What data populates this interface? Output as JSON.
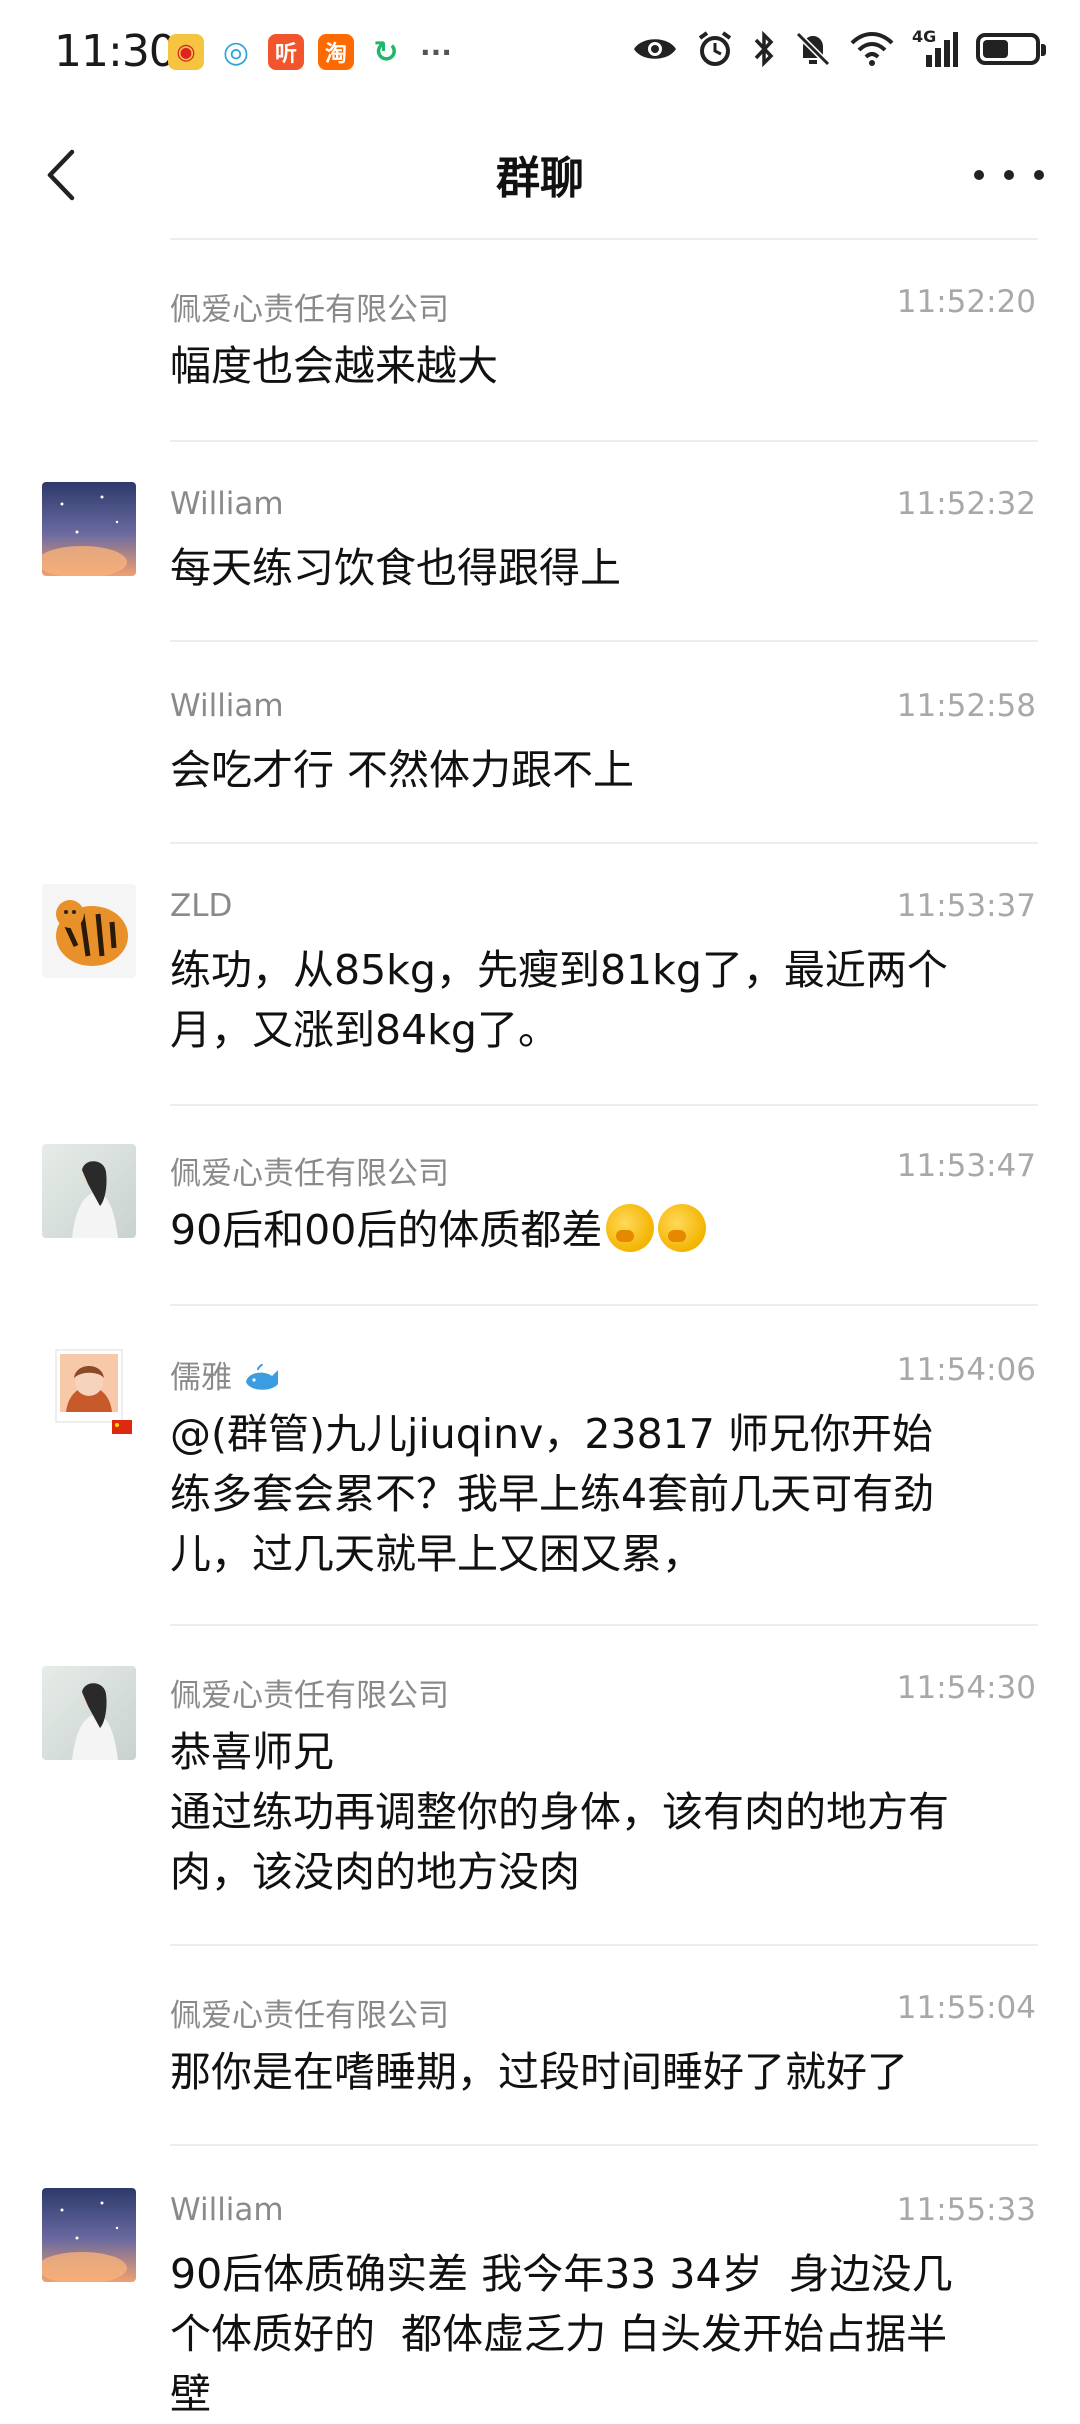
{
  "status_bar": {
    "time": "11:30",
    "notif_icons": [
      {
        "name": "weibo-icon",
        "glyph": "W",
        "color": "#f5c542"
      },
      {
        "name": "chat-bubble-icon",
        "glyph": "◎",
        "color": "#2fa6d6"
      },
      {
        "name": "ting-app-icon",
        "glyph": "听",
        "color": "#f2552c"
      },
      {
        "name": "taobao-icon",
        "glyph": "淘",
        "color": "#ff6a00"
      },
      {
        "name": "sync-icon",
        "glyph": "↻",
        "color": "#1fb86a"
      },
      {
        "name": "more-notifications-icon",
        "glyph": "···",
        "color": "#555555"
      }
    ],
    "network": "4G",
    "battery_level": 0.52
  },
  "header": {
    "title": "群聊"
  },
  "messages": [
    {
      "sender": "佩爱心责任有限公司",
      "time": "11:52:20",
      "text": "幅度也会越来越大",
      "avatar": ""
    },
    {
      "sender": "William",
      "time": "11:52:32",
      "text": "每天练习饮食也得跟得上",
      "avatar": "sunset"
    },
    {
      "sender": "William",
      "time": "11:52:58",
      "text": "会吃才行 不然体力跟不上",
      "avatar": ""
    },
    {
      "sender": "ZLD",
      "time": "11:53:37",
      "text": "练功，从85kg，先瘦到81kg了，最近两个\n月，又涨到84kg了。",
      "avatar": "tiger"
    },
    {
      "sender": "佩爱心责任有限公司",
      "time": "11:53:47",
      "text": "90后和00后的体质都差",
      "emoji_count": 2,
      "avatar": "lady"
    },
    {
      "sender": "儒雅",
      "time": "11:54:06",
      "text": "@(群管)九儿jiuqinv，23817 师兄你开始\n练多套会累不？我早上练4套前几天可有劲\n儿，过几天就早上又困又累，",
      "avatar": "woman"
    },
    {
      "sender": "佩爱心责任有限公司",
      "time": "11:54:30",
      "text": "恭喜师兄\n通过练功再调整你的身体，该有肉的地方有\n肉，该没肉的地方没肉",
      "avatar": "lady"
    },
    {
      "sender": "佩爱心责任有限公司",
      "time": "11:55:04",
      "text": "那你是在嗜睡期，过段时间睡好了就好了",
      "avatar": ""
    },
    {
      "sender": "William",
      "time": "11:55:33",
      "text": "90后体质确实差 我今年33 34岁  身边没几\n个体质好的  都体虚乏力 白头发开始占据半\n壁",
      "avatar": "sunset"
    }
  ]
}
